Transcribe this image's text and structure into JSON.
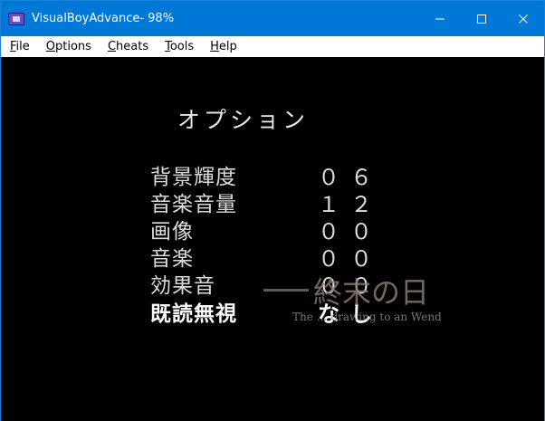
{
  "window": {
    "title": "VisualBoyAdvance- 98%",
    "icon": "visualboyadvance-icon",
    "accent_color": "#0078d7"
  },
  "menubar": {
    "items": [
      {
        "label_ul": "F",
        "label_rest": "ile"
      },
      {
        "label_ul": "O",
        "label_rest": "ptions"
      },
      {
        "label_ul": "C",
        "label_rest": "heats"
      },
      {
        "label_ul": "T",
        "label_rest": "ools"
      },
      {
        "label_ul": "H",
        "label_rest": "elp"
      }
    ]
  },
  "game": {
    "menu_title": "オプション",
    "options": [
      {
        "label": "背景輝度",
        "value": "０６"
      },
      {
        "label": "音楽音量",
        "value": "１２"
      },
      {
        "label": "画像",
        "value": "００"
      },
      {
        "label": "音楽",
        "value": "００"
      },
      {
        "label": "効果音",
        "value": "００"
      },
      {
        "label": "既読無視",
        "value": "なし"
      }
    ],
    "overlay_title": "終末の日",
    "overlay_subtitle": "The … drawing to an Wend"
  }
}
